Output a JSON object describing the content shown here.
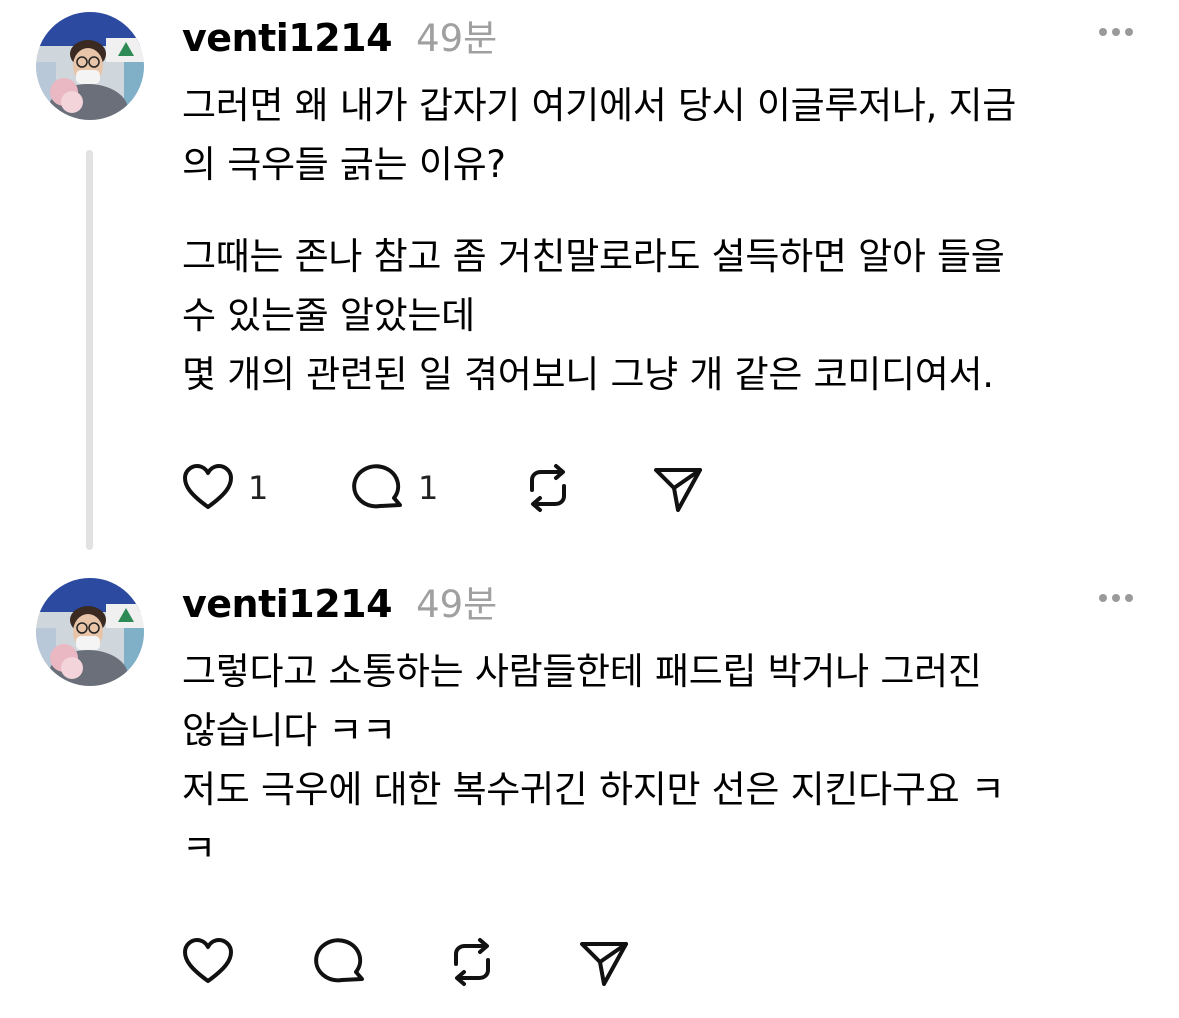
{
  "posts": [
    {
      "username": "venti1214",
      "time": "49분",
      "paragraphs": [
        "그러면 왜 내가 갑자기 여기에서 당시 이글루저나, 지금\n의 극우들 긁는 이유?",
        "그때는 존나 참고 좀 거친말로라도 설득하면 알아 들을\n수 있는줄 알았는데\n몇 개의 관련된 일 겪어보니 그냥 개 같은 코미디여서."
      ],
      "like_count": "1",
      "comment_count": "1",
      "icons": [
        "heart-icon",
        "comment-icon",
        "repost-icon",
        "send-icon",
        "more-icon"
      ]
    },
    {
      "username": "venti1214",
      "time": "49분",
      "paragraphs": [
        "그렇다고 소통하는 사람들한테 패드립 박거나 그러진\n않습니다 ㅋㅋ\n저도 극우에 대한 복수귀긴 하지만 선은 지킨다구요 ㅋ\nㅋ"
      ],
      "like_count": "",
      "comment_count": "",
      "icons": [
        "heart-icon",
        "comment-icon",
        "repost-icon",
        "send-icon",
        "more-icon"
      ]
    }
  ]
}
